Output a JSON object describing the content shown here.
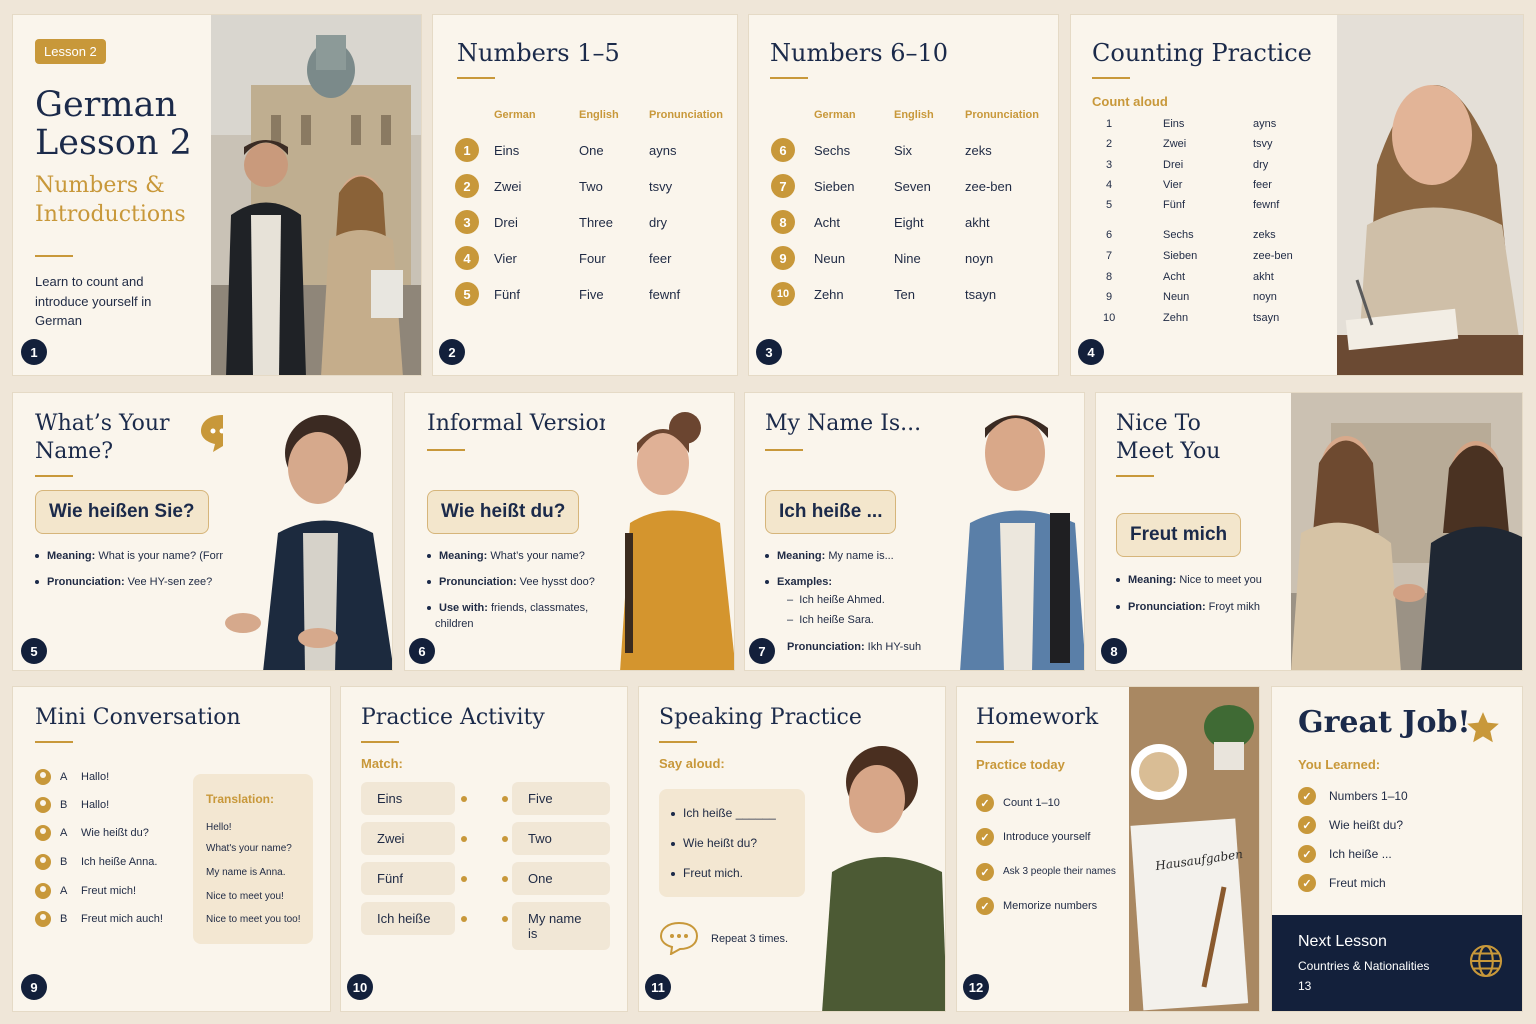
{
  "s1": {
    "badge": "Lesson 2",
    "title1": "German",
    "title2": "Lesson 2",
    "subtitle1": "Numbers &",
    "subtitle2": "Introductions",
    "desc": "Learn to count and introduce yourself in German",
    "num": "1"
  },
  "s2": {
    "title": "Numbers 1–5",
    "headers": [
      "German",
      "English",
      "Pronunciation"
    ],
    "rows": [
      {
        "n": "1",
        "de": "Eins",
        "en": "One",
        "pr": "ayns"
      },
      {
        "n": "2",
        "de": "Zwei",
        "en": "Two",
        "pr": "tsvy"
      },
      {
        "n": "3",
        "de": "Drei",
        "en": "Three",
        "pr": "dry"
      },
      {
        "n": "4",
        "de": "Vier",
        "en": "Four",
        "pr": "feer"
      },
      {
        "n": "5",
        "de": "Fünf",
        "en": "Five",
        "pr": "fewnf"
      }
    ],
    "num": "2"
  },
  "s3": {
    "title": "Numbers 6–10",
    "headers": [
      "German",
      "English",
      "Pronunciation"
    ],
    "rows": [
      {
        "n": "6",
        "de": "Sechs",
        "en": "Six",
        "pr": "zeks"
      },
      {
        "n": "7",
        "de": "Sieben",
        "en": "Seven",
        "pr": "zee-ben"
      },
      {
        "n": "8",
        "de": "Acht",
        "en": "Eight",
        "pr": "akht"
      },
      {
        "n": "9",
        "de": "Neun",
        "en": "Nine",
        "pr": "noyn"
      },
      {
        "n": "10",
        "de": "Zehn",
        "en": "Ten",
        "pr": "tsayn"
      }
    ],
    "num": "3"
  },
  "s4": {
    "title": "Counting Practice",
    "label": "Count aloud",
    "rows": [
      [
        "1",
        "Eins",
        "ayns"
      ],
      [
        "2",
        "Zwei",
        "tsvy"
      ],
      [
        "3",
        "Drei",
        "dry"
      ],
      [
        "4",
        "Vier",
        "feer"
      ],
      [
        "5",
        "Fünf",
        "fewnf"
      ],
      [
        "6",
        "Sechs",
        "zeks"
      ],
      [
        "7",
        "Sieben",
        "zee-ben"
      ],
      [
        "8",
        "Acht",
        "akht"
      ],
      [
        "9",
        "Neun",
        "noyn"
      ],
      [
        "10",
        "Zehn",
        "tsayn"
      ]
    ],
    "num": "4"
  },
  "s5": {
    "title1": "What’s Your",
    "title2": "Name?",
    "phrase": "Wie heißen Sie?",
    "b1k": "Meaning:",
    "b1v": " What is your name? (Formal)",
    "b2k": "Pronunciation:",
    "b2v": " Vee HY-sen zee?",
    "num": "5"
  },
  "s6": {
    "title": "Informal Version",
    "phrase": "Wie heißt du?",
    "b1k": "Meaning:",
    "b1v": " What’s your name?",
    "b2k": "Pronunciation:",
    "b2v": " Vee hysst doo?",
    "b3k": "Use with:",
    "b3v": " friends, classmates,",
    "b3v2": "children",
    "num": "6"
  },
  "s7": {
    "title": "My Name Is...",
    "phrase": "Ich heiße ...",
    "b1k": "Meaning:",
    "b1v": " My name is...",
    "b2k": "Examples:",
    "ex1": "Ich heiße Ahmed.",
    "ex2": "Ich heiße Sara.",
    "b3k": "Pronunciation:",
    "b3v": " Ikh HY-suh",
    "num": "7"
  },
  "s8": {
    "title1": "Nice To",
    "title2": "Meet You",
    "phrase": "Freut mich",
    "b1k": "Meaning:",
    "b1v": " Nice to meet you",
    "b2k": "Pronunciation:",
    "b2v": " Froyt mikh",
    "num": "8"
  },
  "s9": {
    "title": "Mini Conversation",
    "lines": [
      [
        "A",
        "Hallo!"
      ],
      [
        "B",
        "Hallo!"
      ],
      [
        "A",
        "Wie heißt du?"
      ],
      [
        "B",
        "Ich heiße Anna."
      ],
      [
        "A",
        "Freut mich!"
      ],
      [
        "B",
        "Freut mich auch!"
      ]
    ],
    "trans_label": "Translation:",
    "trans": [
      "Hello!",
      "What's your name?",
      "My name is Anna.",
      "Nice to meet you!",
      "Nice to meet you too!"
    ],
    "num": "9"
  },
  "s10": {
    "title": "Practice Activity",
    "label": "Match:",
    "left": [
      "Eins",
      "Zwei",
      "Fünf",
      "Ich heiße"
    ],
    "right": [
      "Five",
      "Two",
      "One",
      "My name is"
    ],
    "num": "10"
  },
  "s11": {
    "title": "Speaking Practice",
    "label": "Say aloud:",
    "items": [
      "Ich heiße ______",
      "Wie heißt du?",
      "Freut mich."
    ],
    "repeat": "Repeat 3 times.",
    "num": "11"
  },
  "s12": {
    "title": "Homework",
    "label": "Practice today",
    "items": [
      "Count 1–10",
      "Introduce yourself",
      "Ask 3 people their names",
      "Memorize numbers"
    ],
    "note": "Hausaufgaben",
    "num": "12"
  },
  "s13": {
    "title": "Great Job!",
    "label": "You Learned:",
    "items": [
      "Numbers 1–10",
      "Wie heißt du?",
      "Ich heiße ...",
      "Freut mich"
    ],
    "next": "Next Lesson",
    "next_sub": "Countries & Nationalities",
    "num": "13"
  }
}
